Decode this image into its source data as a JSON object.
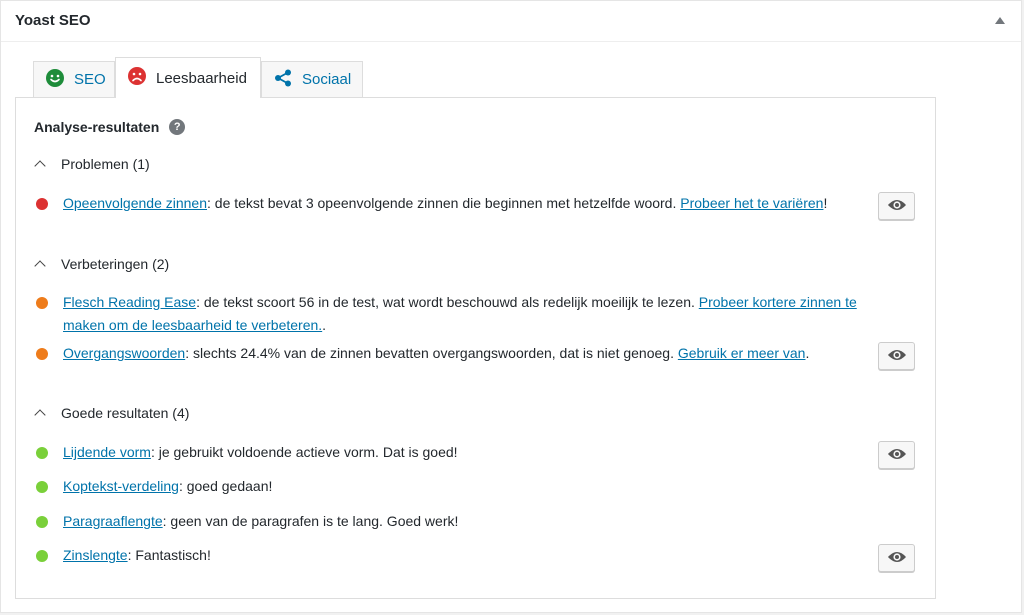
{
  "metabox": {
    "title": "Yoast SEO"
  },
  "tabs": [
    {
      "label": "SEO",
      "icon": "smiley-happy-icon",
      "color": "#1e8c3a"
    },
    {
      "label": "Leesbaarheid",
      "icon": "smiley-sad-icon",
      "color": "#dc3232"
    },
    {
      "label": "Sociaal",
      "icon": "share-icon",
      "color": "#0073aa"
    }
  ],
  "panel": {
    "heading": "Analyse-resultaten",
    "help_icon": "?"
  },
  "sections": {
    "problems": {
      "label": "Problemen (1)"
    },
    "improvements": {
      "label": "Verbeteringen (2)"
    },
    "good": {
      "label": "Goede resultaten (4)"
    }
  },
  "results": {
    "r1": {
      "status": "bad",
      "link": "Opeenvolgende zinnen",
      "text": ": de tekst bevat 3 opeenvolgende zinnen die beginnen met hetzelfde woord. ",
      "action": "Probeer het te variëren",
      "suffix": "!"
    },
    "r2": {
      "status": "ok",
      "link": "Flesch Reading Ease",
      "text": ": de tekst scoort 56 in de test, wat wordt beschouwd als redelijk moeilijk te lezen. ",
      "action": "Probeer kortere zinnen te maken om de leesbaarheid te verbeteren.",
      "suffix": "."
    },
    "r3": {
      "status": "ok",
      "link": "Overgangswoorden",
      "text": ": slechts 24.4% van de zinnen bevatten overgangswoorden, dat is niet genoeg. ",
      "action": "Gebruik er meer van",
      "suffix": "."
    },
    "r4": {
      "status": "good",
      "link": "Lijdende vorm",
      "text": ": je gebruikt voldoende actieve vorm. Dat is goed!"
    },
    "r5": {
      "status": "good",
      "link": "Koptekst-verdeling",
      "text": ": goed gedaan!"
    },
    "r6": {
      "status": "good",
      "link": "Paragraaflengte",
      "text": ": geen van de paragrafen is te lang. Goed werk!"
    },
    "r7": {
      "status": "good",
      "link": "Zinslengte",
      "text": ": Fantastisch!"
    }
  },
  "colors": {
    "bad": "#dc3232",
    "ok": "#ee7c1b",
    "good": "#7ad03a",
    "link": "#0073aa"
  }
}
